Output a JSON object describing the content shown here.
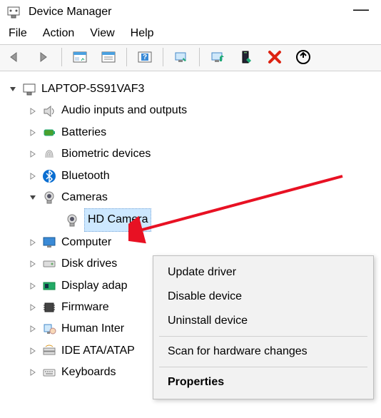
{
  "title": "Device Manager",
  "menu": {
    "file": "File",
    "action": "Action",
    "view": "View",
    "help": "Help"
  },
  "root": {
    "label": "LAPTOP-5S91VAF3"
  },
  "categories": [
    {
      "key": "audio",
      "label": "Audio inputs and outputs",
      "expanded": false
    },
    {
      "key": "batteries",
      "label": "Batteries",
      "expanded": false
    },
    {
      "key": "biometric",
      "label": "Biometric devices",
      "expanded": false
    },
    {
      "key": "bluetooth",
      "label": "Bluetooth",
      "expanded": false
    },
    {
      "key": "cameras",
      "label": "Cameras",
      "expanded": true,
      "child": {
        "label": "HD Camera",
        "selected": true
      }
    },
    {
      "key": "computer",
      "label": "Computer",
      "expanded": false
    },
    {
      "key": "disk",
      "label": "Disk drives",
      "expanded": false
    },
    {
      "key": "display",
      "label": "Display adap",
      "expanded": false
    },
    {
      "key": "firmware",
      "label": "Firmware",
      "expanded": false
    },
    {
      "key": "hid",
      "label": "Human Inter",
      "expanded": false
    },
    {
      "key": "ide",
      "label": "IDE ATA/ATAP",
      "expanded": false
    },
    {
      "key": "keyboards",
      "label": "Keyboards",
      "expanded": false
    }
  ],
  "context_menu": {
    "update": "Update driver",
    "disable": "Disable device",
    "uninstall": "Uninstall device",
    "scan": "Scan for hardware changes",
    "properties": "Properties"
  }
}
